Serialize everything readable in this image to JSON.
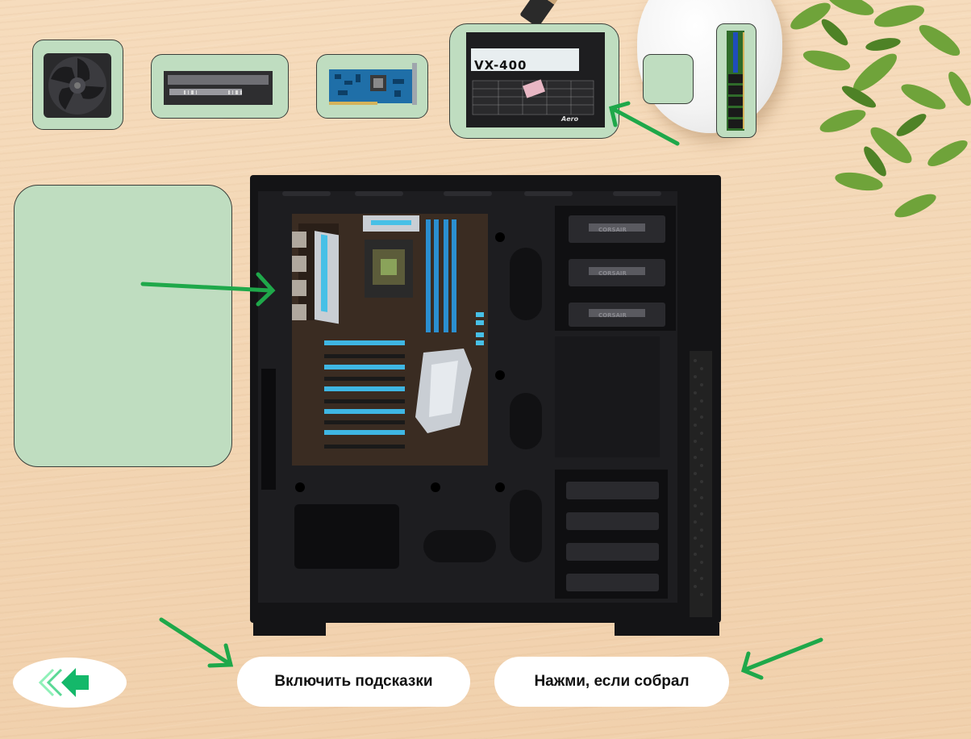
{
  "buttons": {
    "hints": "Включить подсказки",
    "assembled": "Нажми, если собрал"
  },
  "tray": {
    "items": [
      {
        "name": "case-fan"
      },
      {
        "name": "hard-drive"
      },
      {
        "name": "graphics-card"
      },
      {
        "name": "power-supply",
        "model_label": "VX-400",
        "brand_label": "Aero"
      },
      {
        "name": "empty-slot"
      },
      {
        "name": "ram-module"
      }
    ]
  },
  "case": {
    "bay_brand": "CORSAIR"
  },
  "colors": {
    "slot_fill": "#bfddc0",
    "hint_arrow": "#1fa84a",
    "back_arrow_light": "#8ff0b8",
    "back_arrow_dark": "#14b86a"
  }
}
